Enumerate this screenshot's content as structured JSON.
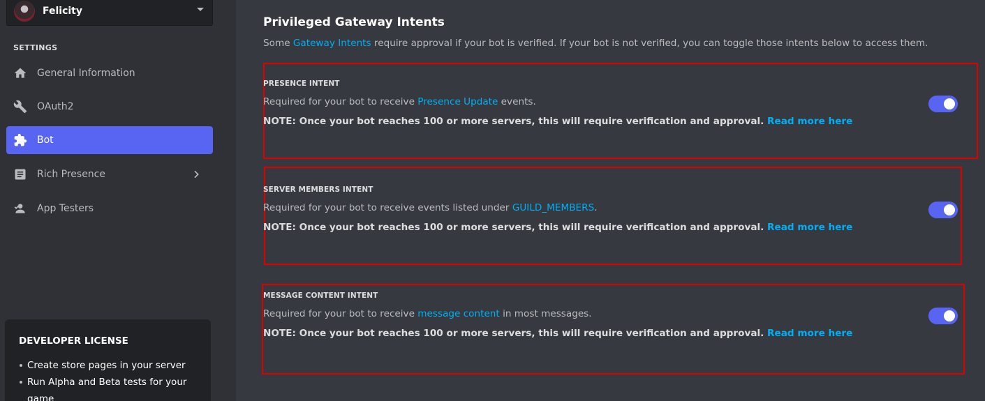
{
  "colors": {
    "sidebar_bg": "#2f3136",
    "main_bg": "#36393f",
    "accent": "#5865f2",
    "link": "#00aff4",
    "highlight_border": "#e00000"
  },
  "app_selector": {
    "name": "Felicity"
  },
  "sidebar": {
    "heading": "SETTINGS",
    "items": [
      {
        "label": "General Information",
        "icon": "home-icon"
      },
      {
        "label": "OAuth2",
        "icon": "wrench-icon"
      },
      {
        "label": "Bot",
        "icon": "puzzle-icon",
        "active": true
      },
      {
        "label": "Rich Presence",
        "icon": "document-icon",
        "has_submenu": true
      },
      {
        "label": "App Testers",
        "icon": "user-testers-icon"
      }
    ]
  },
  "license": {
    "title": "DEVELOPER LICENSE",
    "items": [
      "Create store pages in your server",
      "Run Alpha and Beta tests for your game"
    ]
  },
  "section": {
    "title": "Privileged Gateway Intents",
    "desc_prefix": "Some ",
    "desc_link": "Gateway Intents",
    "desc_suffix": " require approval if your bot is verified. If your bot is not verified, you can toggle those intents below to access them."
  },
  "intents": [
    {
      "label": "PRESENCE INTENT",
      "desc_prefix": "Required for your bot to receive ",
      "desc_link": "Presence Update",
      "desc_suffix": " events.",
      "note": "NOTE: Once your bot reaches 100 or more servers, this will require verification and approval. ",
      "note_link": "Read more here",
      "enabled": true
    },
    {
      "label": "SERVER MEMBERS INTENT",
      "desc_prefix": "Required for your bot to receive events listed under ",
      "desc_link": "GUILD_MEMBERS",
      "desc_suffix": ".",
      "note": "NOTE: Once your bot reaches 100 or more servers, this will require verification and approval. ",
      "note_link": "Read more here",
      "enabled": true
    },
    {
      "label": "MESSAGE CONTENT INTENT",
      "desc_prefix": "Required for your bot to receive ",
      "desc_link": "message content",
      "desc_suffix": " in most messages.",
      "note": "NOTE: Once your bot reaches 100 or more servers, this will require verification and approval. ",
      "note_link": "Read more here",
      "enabled": true
    }
  ]
}
